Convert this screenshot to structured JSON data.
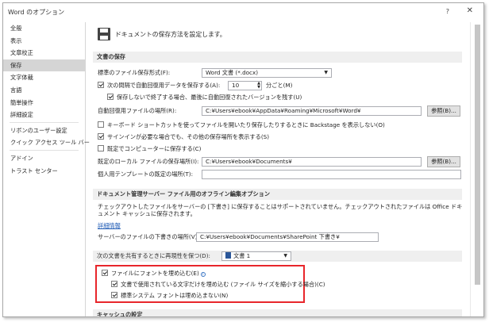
{
  "window": {
    "title": "Word のオプション",
    "help": "?",
    "close": "✕"
  },
  "sidebar": {
    "items": [
      {
        "label": "全般"
      },
      {
        "label": "表示"
      },
      {
        "label": "文章校正"
      },
      {
        "label": "保存",
        "active": true
      },
      {
        "label": "文字体裁"
      },
      {
        "label": "言語"
      },
      {
        "label": "簡単操作"
      },
      {
        "label": "詳細設定"
      },
      {
        "label": "リボンのユーザー設定"
      },
      {
        "label": "クイック アクセス ツール バー"
      },
      {
        "label": "アドイン"
      },
      {
        "label": "トラスト センター"
      }
    ]
  },
  "header": {
    "text": "ドキュメントの保存方法を設定します。"
  },
  "save_section": {
    "title": "文書の保存",
    "format_label": "標準のファイル保存形式(F):",
    "format_value": "Word 文書 (*.docx)",
    "autorecover_label": "次の間隔で自動回復用データを保存する(A):",
    "autorecover_checked": true,
    "autorecover_minutes": "10",
    "minutes_unit": "分ごと(M)",
    "keep_last_label": "保存しないで終了する場合、最後に自動回復されたバージョンを残す(U)",
    "keep_last_checked": true,
    "autorecover_location_label": "自動回復用ファイルの場所(R):",
    "autorecover_location_value": "C:¥Users¥ebook¥AppData¥Roaming¥Microsoft¥Word¥",
    "browse1": "参照(B)...",
    "no_backstage_label": "キーボード ショートカットを使ってファイルを開いたり保存したりするときに Backstage を表示しない(O)",
    "no_backstage_checked": false,
    "show_more_label": "サインインが必要な場合でも、その他の保存場所を表示する(S)",
    "show_more_checked": true,
    "default_computer_label": "既定でコンピューターに保存する(C)",
    "default_computer_checked": false,
    "local_location_label": "既定のローカル ファイルの保存場所(I):",
    "local_location_value": "C:¥Users¥ebook¥Documents¥",
    "browse2": "参照(B)...",
    "template_label": "個人用テンプレートの既定の場所(T):",
    "template_value": ""
  },
  "offline_section": {
    "title": "ドキュメント管理サーバー ファイル用のオフライン編集オプション",
    "note": "チェックアウトしたファイルをサーバーの [下書き] に保存することはサポートされていません。チェックアウトされたファイルは Office ドキュメント キャッシュに保存されます。",
    "details_link": "詳細情報",
    "drafts_label": "サーバーのファイルの下書きの場所(V):",
    "drafts_value": "C:¥Users¥ebook¥Documents¥SharePoint 下書き¥"
  },
  "fidelity_section": {
    "title": "次の文書を共有するときに再現性を保つ(D):",
    "doc_value": "文書 1",
    "embed_fonts_label": "ファイルにフォントを埋め込む(E)",
    "embed_fonts_checked": true,
    "used_chars_label": "文書で使用されている文字だけを埋め込む (ファイル サイズを縮小する場合)(C)",
    "used_chars_checked": true,
    "no_system_fonts_label": "標準システム フォントは埋め込まない(N)",
    "no_system_fonts_checked": true
  },
  "cache_section": {
    "title": "キャッシュの設定"
  }
}
